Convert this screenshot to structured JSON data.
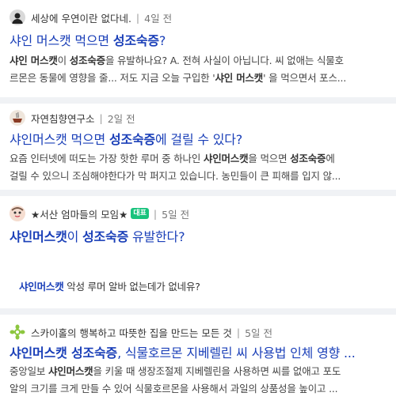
{
  "posts": [
    {
      "author": "세상에 우연이란 없다네.",
      "time": "4일 전",
      "title_pre": "샤인 머스캣 먹으면 ",
      "title_bold": "성조숙증",
      "title_post": "?",
      "line1_parts": [
        "샤인 머스캣",
        "이 ",
        "성조숙증",
        "을 유발하나요? A. 전혀 사실이 아닙니다. 씨 없애는 식물호"
      ],
      "line2_parts": [
        "르몬은 동물에 영향을 줄... 저도 지금 오늘 구입한 '",
        "샤인 머스캣",
        "' 을 먹으면서 포스..."
      ]
    },
    {
      "author": "자연침향연구소",
      "time": "2일 전",
      "title_pre": "샤인머스캣 먹으면 ",
      "title_bold": "성조숙증",
      "title_post": "에 걸릴 수 있다?",
      "line1_parts": [
        "요즘 인터넷에 떠도는 가장 핫한 루머 중 하나인 ",
        "샤인머스캣",
        "을 먹으면 ",
        "성조숙증",
        "에"
      ],
      "line2_parts": [
        "걸릴 수 있으니 조심해야한다가 막 퍼지고 있습니다. 농민들이 큰 피해를 입지 않..."
      ]
    },
    {
      "author": "★서산 엄마들의 모임★",
      "badge": "대표",
      "time": "5일 전",
      "title_pre": "샤인머스캣",
      "title_mid": "이 ",
      "title_bold": "성조숙증",
      "title_post": " 유발한다?",
      "sub_bold": "샤인머스캣",
      "sub_rest": " 악성 루머 알바 없는데가 없네유?"
    },
    {
      "author": "스카이홀의 행복하고 따뜻한 집을 만드는 모든 것",
      "time": "5일 전",
      "title_pre": "샤인머스캣 성조숙증",
      "title_post": ", 식물호르몬 지베렐린 씨 사용법 인체 영향 ...",
      "line1_parts": [
        "중앙일보 ",
        "샤인머스캣",
        "을 키울 때 생장조절제 지베렐린을 사용하면 씨를 없애고 포도"
      ],
      "line2_parts": [
        "알의 크기를 크게 만들 수 있어 식물호르몬을 사용해서 과일의 상품성을 높이고 ..."
      ]
    }
  ],
  "icons": [
    "user-silhouette-icon",
    "incense-bowl-icon",
    "cartoon-face-icon",
    "green-leaf-icon"
  ],
  "colors": {
    "link": "#1a3fb8",
    "badge": "#19c37d",
    "divider": "#f0f2f5"
  }
}
